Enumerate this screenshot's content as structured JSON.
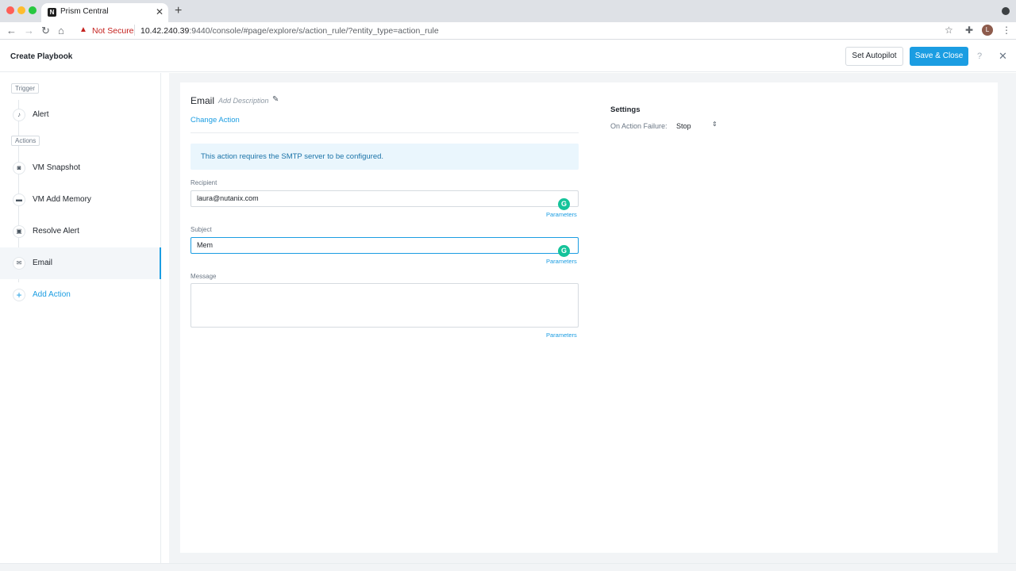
{
  "browser": {
    "tab_title": "Prism Central",
    "tab_favicon": "N",
    "security_label": "Not Secure",
    "url_host": "10.42.240.39",
    "url_rest": ":9440/console/#page/explore/s/action_rule/?entity_type=action_rule",
    "profile_initial": "L"
  },
  "header": {
    "title": "Create Playbook",
    "set_autopilot_label": "Set Autopilot",
    "save_close_label": "Save & Close",
    "help_glyph": "?",
    "close_glyph": "✕"
  },
  "sidebar": {
    "trigger_label": "Trigger",
    "actions_label": "Actions",
    "trigger_item": {
      "label": "Alert",
      "icon": "bell-icon"
    },
    "action_items": [
      {
        "label": "VM Snapshot",
        "icon": "camera-icon"
      },
      {
        "label": "VM Add Memory",
        "icon": "memory-icon"
      },
      {
        "label": "Resolve Alert",
        "icon": "clipboard-icon"
      },
      {
        "label": "Email",
        "icon": "envelope-icon",
        "active": true
      }
    ],
    "add_action_label": "Add Action"
  },
  "action": {
    "title": "Email",
    "add_description": "Add Description",
    "change_action": "Change Action",
    "info_message": "This action requires the SMTP server to be configured.",
    "recipient_label": "Recipient",
    "recipient_value": "laura@nutanix.com",
    "subject_label": "Subject",
    "subject_value": "Mem",
    "message_label": "Message",
    "message_value": "",
    "parameters_label": "Parameters"
  },
  "settings": {
    "title": "Settings",
    "on_failure_label": "On Action Failure:",
    "on_failure_value": "Stop"
  },
  "colors": {
    "accent": "#1b9de2",
    "info_bg": "#eaf6fd",
    "grammarly": "#15c39a"
  }
}
